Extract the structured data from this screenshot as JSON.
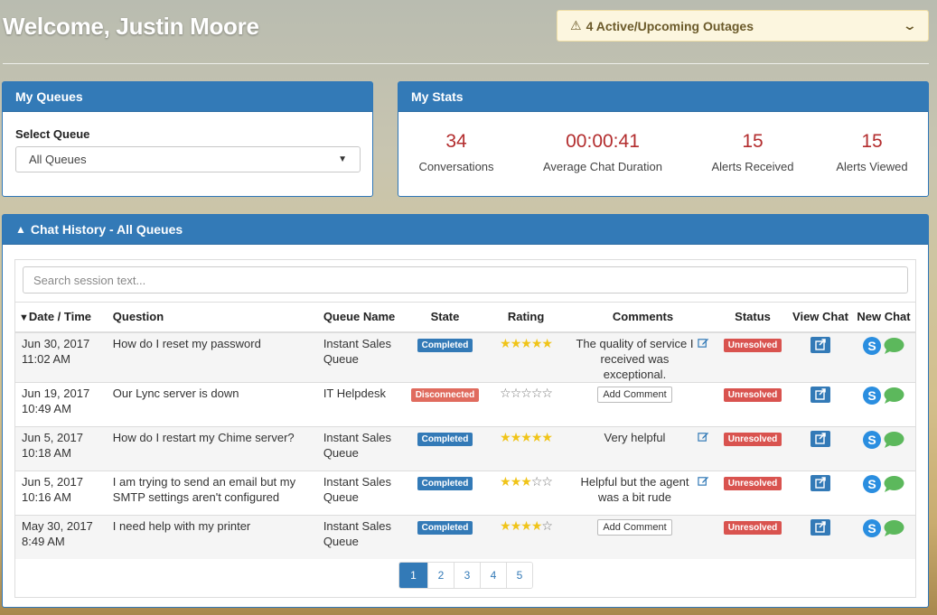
{
  "header": {
    "welcome": "Welcome, Justin Moore",
    "outage_label": "4 Active/Upcoming Outages"
  },
  "queues": {
    "title": "My Queues",
    "select_label": "Select Queue",
    "selected": "All Queues"
  },
  "stats": {
    "title": "My Stats",
    "items": [
      {
        "value": "34",
        "label": "Conversations"
      },
      {
        "value": "00:00:41",
        "label": "Average Chat Duration"
      },
      {
        "value": "15",
        "label": "Alerts Received"
      },
      {
        "value": "15",
        "label": "Alerts Viewed"
      }
    ]
  },
  "history": {
    "title": "Chat History - All Queues",
    "search_placeholder": "Search session text...",
    "columns": [
      "Date / Time",
      "Question",
      "Queue Name",
      "State",
      "Rating",
      "Comments",
      "Status",
      "View Chat",
      "New Chat"
    ],
    "add_comment_label": "Add Comment",
    "rows": [
      {
        "date": "Jun 30, 2017",
        "time": "11:02 AM",
        "question": "How do I reset my password",
        "queue": "Instant Sales Queue",
        "state": "Completed",
        "rating": 5,
        "comment": "The quality of service I received was exceptional.",
        "status": "Unresolved"
      },
      {
        "date": "Jun 19, 2017",
        "time": "10:49 AM",
        "question": "Our Lync server is down",
        "queue": "IT Helpdesk",
        "state": "Disconnected",
        "rating": 0,
        "comment": "",
        "status": "Unresolved"
      },
      {
        "date": "Jun 5, 2017",
        "time": "10:18 AM",
        "question": "How do I restart my Chime server?",
        "queue": "Instant Sales Queue",
        "state": "Completed",
        "rating": 5,
        "comment": "Very helpful",
        "status": "Unresolved"
      },
      {
        "date": "Jun 5, 2017",
        "time": "10:16 AM",
        "question": "I am trying to send an email but my SMTP settings aren't configured",
        "queue": "Instant Sales Queue",
        "state": "Completed",
        "rating": 3,
        "comment": "Helpful but the agent was a bit rude",
        "status": "Unresolved"
      },
      {
        "date": "May 30, 2017",
        "time": "8:49 AM",
        "question": "I need help with my printer",
        "queue": "Instant Sales Queue",
        "state": "Completed",
        "rating": 4,
        "comment": "",
        "status": "Unresolved"
      }
    ],
    "pages": [
      "1",
      "2",
      "3",
      "4",
      "5"
    ],
    "active_page": "1"
  },
  "colors": {
    "primary": "#337ab7",
    "stat_number": "#b32d2e",
    "unresolved": "#d9534f",
    "disconnected": "#e06b5e",
    "star": "#f0c419",
    "skype": "#2a8ee0",
    "chat_bubble": "#5cb85c"
  },
  "icons": {
    "outage": "warning-triangle-icon",
    "outage_toggle": "chevron-down-icon",
    "sort": "sort-desc-icon",
    "collapse": "chevron-up-icon",
    "edit": "edit-icon",
    "view_chat": "external-link-icon",
    "new_chat": [
      "skype-icon",
      "chat-bubble-icon"
    ]
  }
}
